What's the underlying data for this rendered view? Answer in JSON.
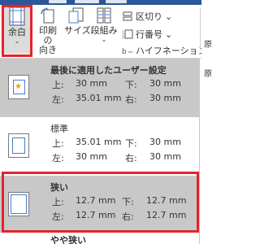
{
  "ribbon": {
    "buttons": {
      "margins": "余白",
      "orientation": "印刷の\n向き",
      "size": "サイズ",
      "columns": "段組み"
    },
    "breaks": "区切り",
    "line_numbers": "行番号",
    "hyphenation": "ハイフネーション",
    "chevron": "⌄",
    "side_labels": [
      "原",
      "原"
    ]
  },
  "margins_menu": {
    "items": [
      {
        "title": "最後に適用したユーザー設定",
        "top_label": "上:",
        "top": "30 mm",
        "bottom_label": "下:",
        "bottom": "30 mm",
        "left_label": "左:",
        "left": "35.01 mm",
        "right_label": "右:",
        "right": "30 mm",
        "selected": false
      },
      {
        "title": "標準",
        "top_label": "上:",
        "top": "35.01 mm",
        "bottom_label": "下:",
        "bottom": "30 mm",
        "left_label": "左:",
        "left": "30 mm",
        "right_label": "右:",
        "right": "30 mm",
        "selected": false
      },
      {
        "title": "狭い",
        "top_label": "上:",
        "top": "12.7 mm",
        "bottom_label": "下:",
        "bottom": "12.7 mm",
        "left_label": "左:",
        "left": "12.7 mm",
        "right_label": "右:",
        "right": "12.7 mm",
        "selected": true
      },
      {
        "title": "やや狭い"
      }
    ]
  },
  "colors": {
    "highlight": "#e3242b",
    "selected_bg": "#c8c8c8",
    "accent": "#4a7cc9"
  }
}
